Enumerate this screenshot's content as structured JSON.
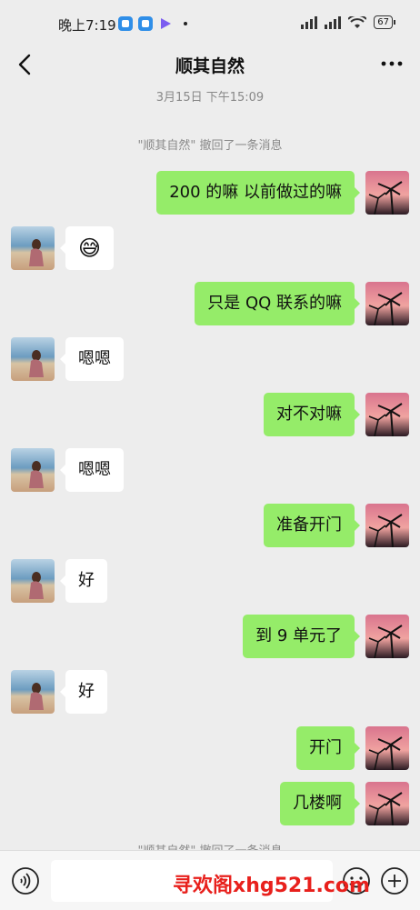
{
  "status_bar": {
    "time": "晚上7:19",
    "battery": "67"
  },
  "header": {
    "title": "顺其自然"
  },
  "timestamp": "3月15日 下午15:09",
  "system_messages": [
    "\"顺其自然\" 撤回了一条消息",
    "\"顺其自然\" 撤回了一条消息"
  ],
  "messages": [
    {
      "side": "out",
      "text": "200 的嘛 以前做过的嘛"
    },
    {
      "side": "in",
      "text": "",
      "emoji": "😅"
    },
    {
      "side": "out",
      "text": "只是 QQ 联系的嘛"
    },
    {
      "side": "in",
      "text": "嗯嗯"
    },
    {
      "side": "out",
      "text": "对不对嘛"
    },
    {
      "side": "in",
      "text": "嗯嗯"
    },
    {
      "side": "out",
      "text": "准备开门"
    },
    {
      "side": "in",
      "text": "好"
    },
    {
      "side": "out",
      "text": "到 9 单元了"
    },
    {
      "side": "in",
      "text": "好"
    },
    {
      "side": "out",
      "text": "开门"
    },
    {
      "side": "out",
      "text": "几楼啊"
    }
  ],
  "watermark": "寻欢阁xhg521.com",
  "colors": {
    "outgoing_bubble": "#95ec69",
    "incoming_bubble": "#ffffff",
    "background": "#ededed"
  }
}
